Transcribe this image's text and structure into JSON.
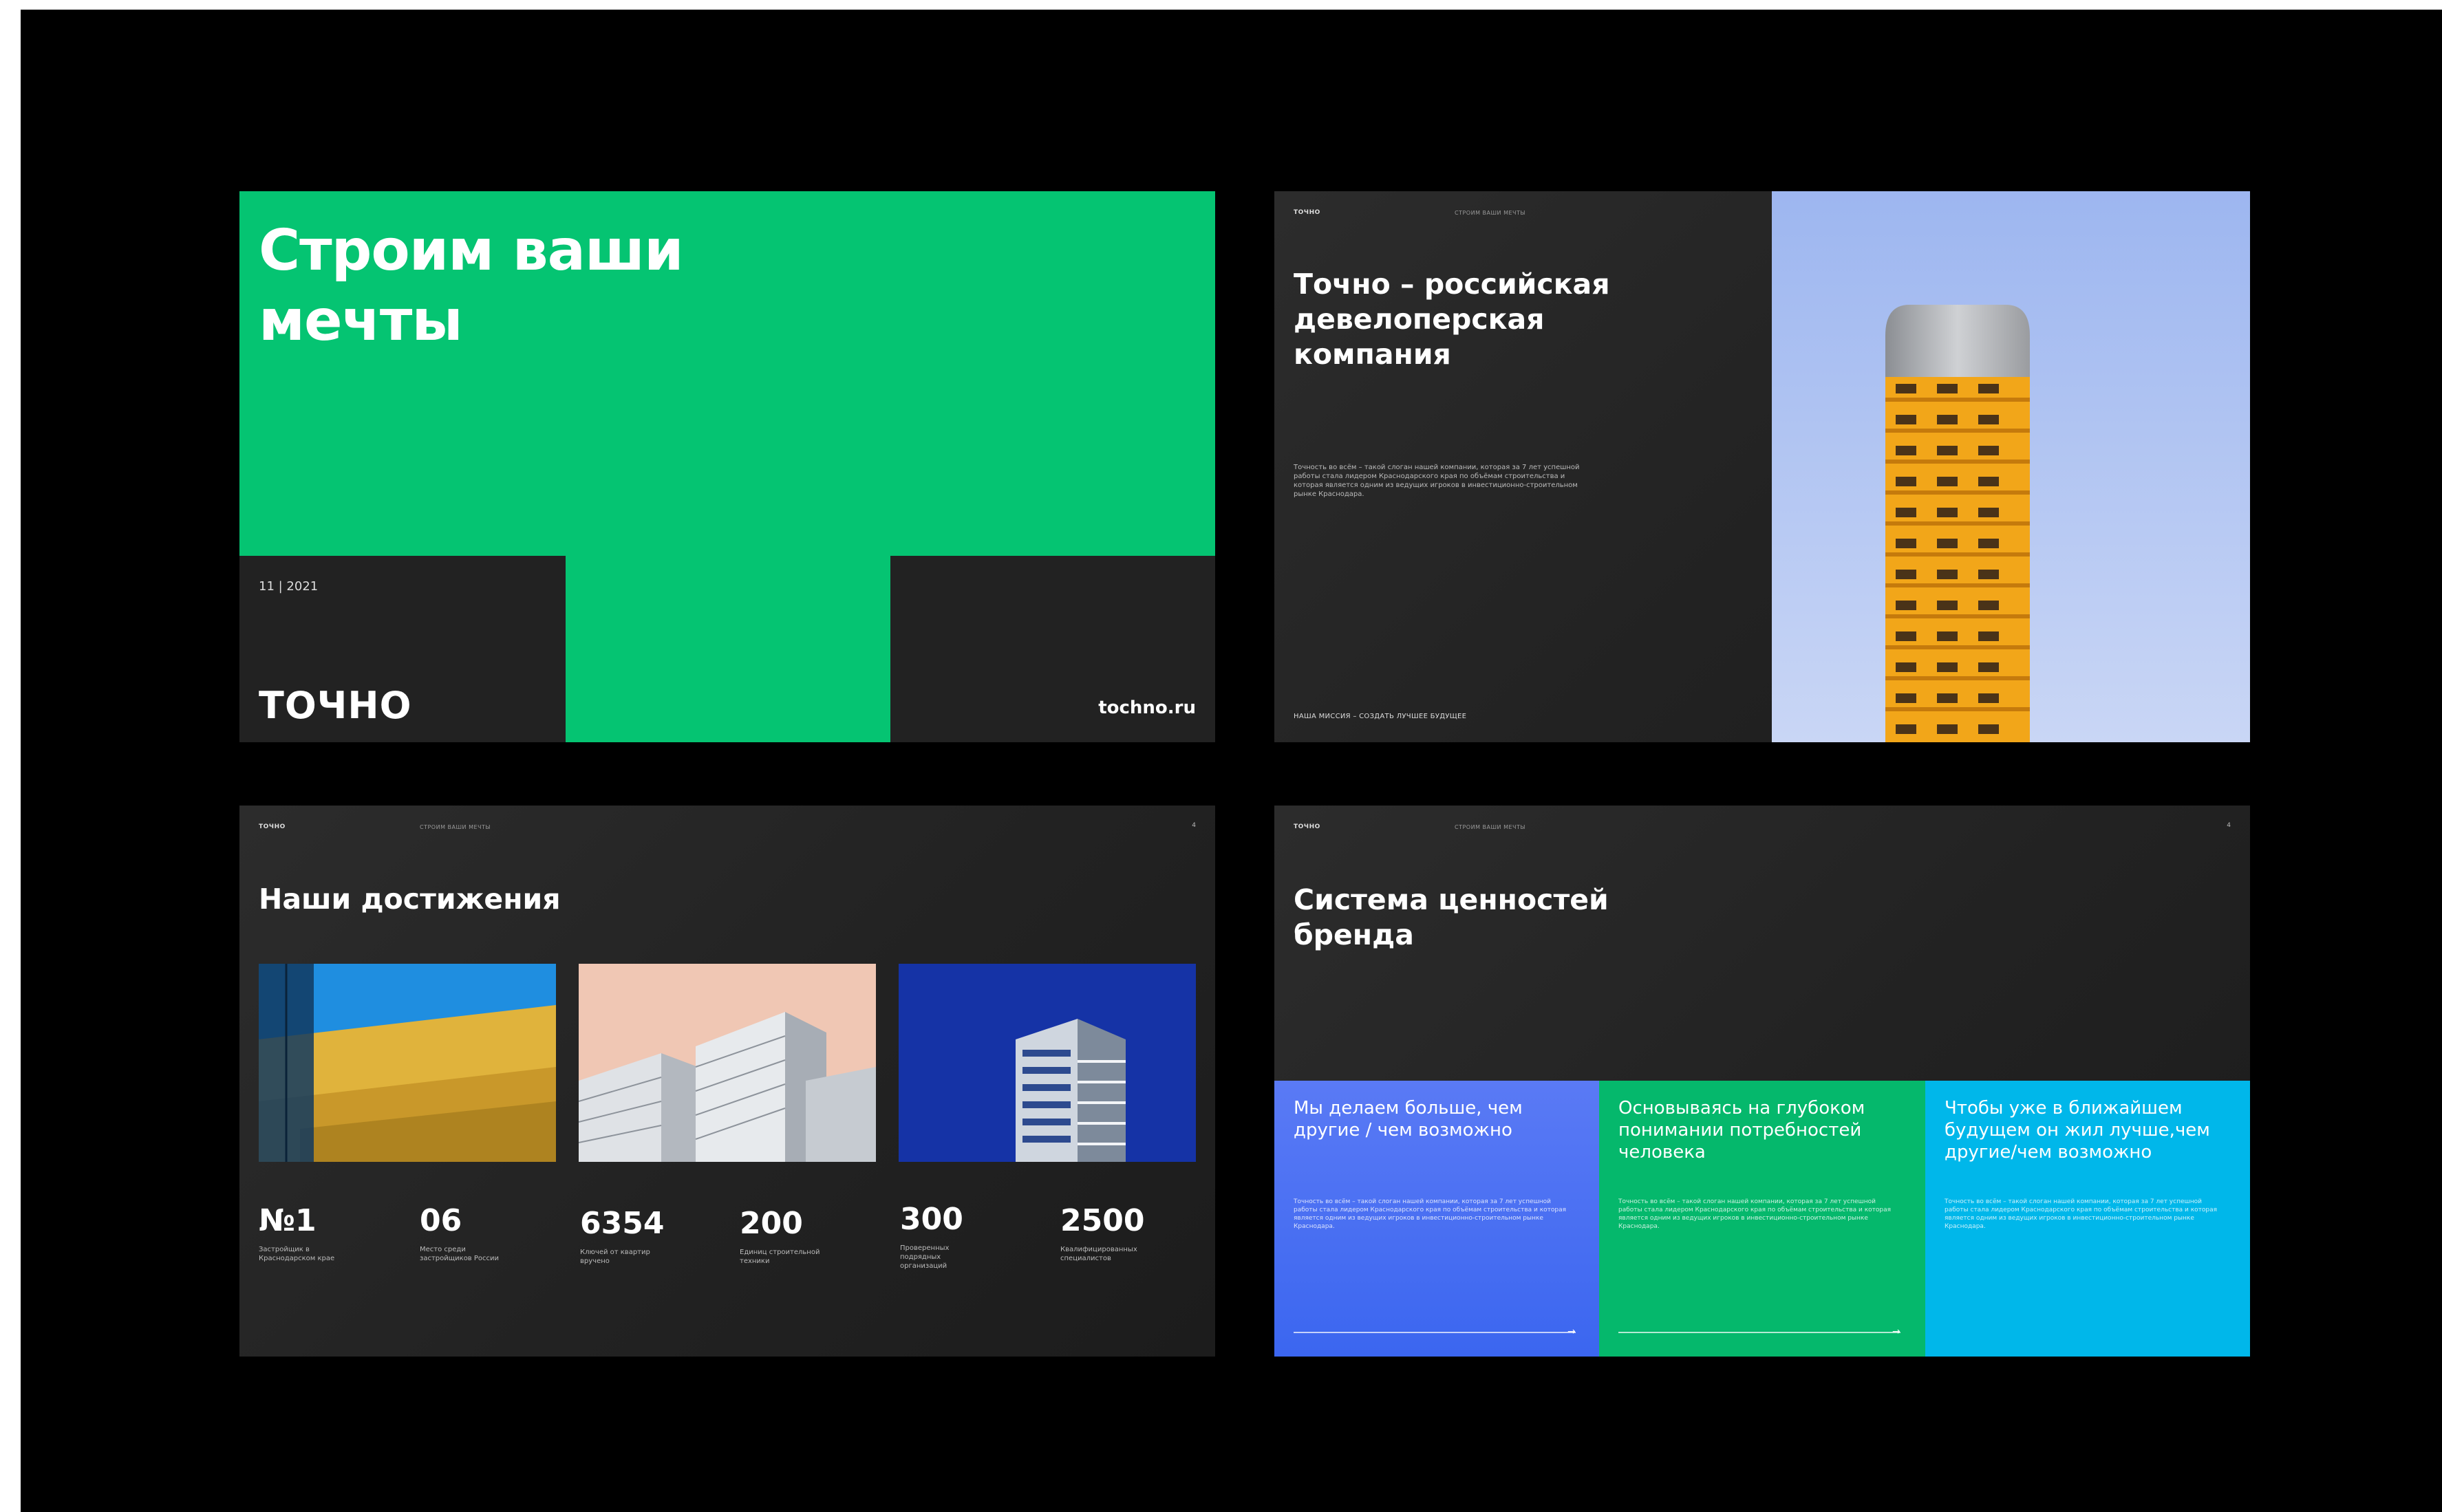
{
  "slide1": {
    "title": "Строим ваши\nмечты",
    "date": "11 | 2021",
    "logo": "ТОЧНО",
    "url": "tochno.ru",
    "green": "#05c472"
  },
  "slide2": {
    "logo": "ТОЧНО",
    "tagline": "СТРОИМ ВАШИ МЕЧТЫ",
    "heading": "Точно – российская\nдевелоперская\nкомпания",
    "paragraph": "Точность во всём – такой слоган нашей компании, которая за 7 лет успешной работы стала лидером Краснодарского края по объёмам строительства и которая является одним из ведущих игроков в инвестиционно-строительном рынке Краснодара.",
    "mission": "НАША МИССИЯ – СОЗДАТЬ ЛУЧШЕЕ БУДУЩЕЕ"
  },
  "slide3": {
    "logo": "ТОЧНО",
    "tagline": "СТРОИМ ВАШИ МЕЧТЫ",
    "page": "4",
    "heading": "Наши достижения",
    "stats": [
      {
        "num": "№1",
        "label": "Застройщик в Краснодарском крае"
      },
      {
        "num": "06",
        "label": "Место среди застройщиков России"
      },
      {
        "num": "6354",
        "label": "Ключей от квартир вручено"
      },
      {
        "num": "200",
        "label": "Единиц строительной техники"
      },
      {
        "num": "300",
        "label": "Проверенных подрядных организаций"
      },
      {
        "num": "2500",
        "label": "Квалифицированных специалистов"
      }
    ]
  },
  "slide4": {
    "logo": "ТОЧНО",
    "tagline": "СТРОИМ ВАШИ МЕЧТЫ",
    "page": "4",
    "heading": "Система ценностей\nбренда",
    "panels": [
      {
        "title": "Мы делаем больше, чем другие / чем возможно",
        "text": "Точность во всём – такой слоган нашей компании, которая за 7 лет успешной работы стала лидером Краснодарского края по объёмам строительства и которая является одним из ведущих игроков в инвестиционно-строительном рынке Краснодара.",
        "color": "#4a72f5"
      },
      {
        "title": "Основываясь на глубоком понимании потребностей человека",
        "text": "Точность во всём – такой слоган нашей компании, которая за 7 лет успешной работы стала лидером Краснодарского края по объёмам строительства и которая является одним из ведущих игроков в инвестиционно-строительном рынке Краснодара.",
        "color": "#05b86c"
      },
      {
        "title": "Чтобы уже в ближайшем будущем он жил лучше,чем другие/чем возможно",
        "text": "Точность во всём – такой слоган нашей компании, которая за 7 лет успешной работы стала лидером Краснодарского края по объёмам строительства и которая является одним из ведущих игроков в инвестиционно-строительном рынке Краснодара.",
        "color": "#00b7ea"
      }
    ]
  }
}
